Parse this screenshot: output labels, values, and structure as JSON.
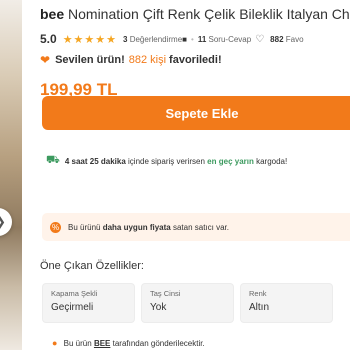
{
  "product": {
    "brand": "bee",
    "name": "Nomination Çift Renk Çelik Bileklik Italyan Cha",
    "rating": "5.0",
    "stars": "★★★★★",
    "review_count": "3",
    "review_label": "Değerlendirme",
    "qa_count": "11",
    "qa_label": "Soru-Cevap",
    "fav_count": "882",
    "fav_label": "Favo",
    "price": "199,99 TL"
  },
  "favorite": {
    "label": "Sevilen ürün!",
    "count": "882 kişi",
    "tail": "favoriledi!"
  },
  "actions": {
    "add_to_cart": "Sepete Ekle"
  },
  "delivery": {
    "time": "4 saat 25 dakika",
    "middle": "içinde sipariş verirsen",
    "highlight": "en geç yarın",
    "tail": "kargoda!"
  },
  "seller_notice": {
    "pre": "Bu ürünü",
    "bold": "daha uygun fiyata",
    "post": "satan satıcı var."
  },
  "features": {
    "title": "Öne Çıkan Özellikler:",
    "items": [
      {
        "name": "Kapama Şekli",
        "value": "Geçirmeli"
      },
      {
        "name": "Taş Cinsi",
        "value": "Yok"
      },
      {
        "name": "Renk",
        "value": "Altın"
      }
    ]
  },
  "shipping_note": {
    "pre": "Bu ürün",
    "brand": "BEE",
    "post": "tarafından gönderilecektir."
  },
  "colors": {
    "accent": "#f27a1a",
    "green": "#3c9a5f"
  },
  "icons": [
    "chevron-right-icon",
    "star-icon",
    "camera-icon",
    "heart-outline-icon",
    "heart-icon",
    "truck-icon",
    "discount-icon"
  ]
}
